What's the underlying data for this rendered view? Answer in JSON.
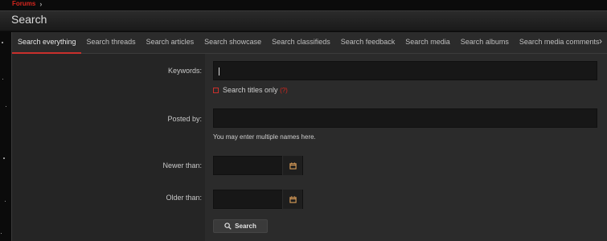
{
  "breadcrumb": {
    "items": [
      "Forums"
    ],
    "separator": "›"
  },
  "page": {
    "title": "Search"
  },
  "tabs": [
    {
      "label": "Search everything",
      "active": true
    },
    {
      "label": "Search threads"
    },
    {
      "label": "Search articles"
    },
    {
      "label": "Search showcase"
    },
    {
      "label": "Search classifieds"
    },
    {
      "label": "Search feedback"
    },
    {
      "label": "Search media"
    },
    {
      "label": "Search albums"
    },
    {
      "label": "Search media comments"
    }
  ],
  "tabs_next_glyph": "›",
  "form": {
    "keywords_label": "Keywords:",
    "titles_only_label": "Search titles only",
    "titles_only_help": "(?)",
    "posted_by_label": "Posted by:",
    "posted_by_hint": "You may enter multiple names here.",
    "newer_than_label": "Newer than:",
    "older_than_label": "Older than:",
    "search_button": "Search"
  },
  "colors": {
    "accent": "#c9302c",
    "link": "#d7261e",
    "background": "#0b0b0b",
    "panel": "#2b2b2b",
    "input": "#171717"
  },
  "icons": {
    "calendar": "calendar-icon",
    "search": "search-icon"
  }
}
